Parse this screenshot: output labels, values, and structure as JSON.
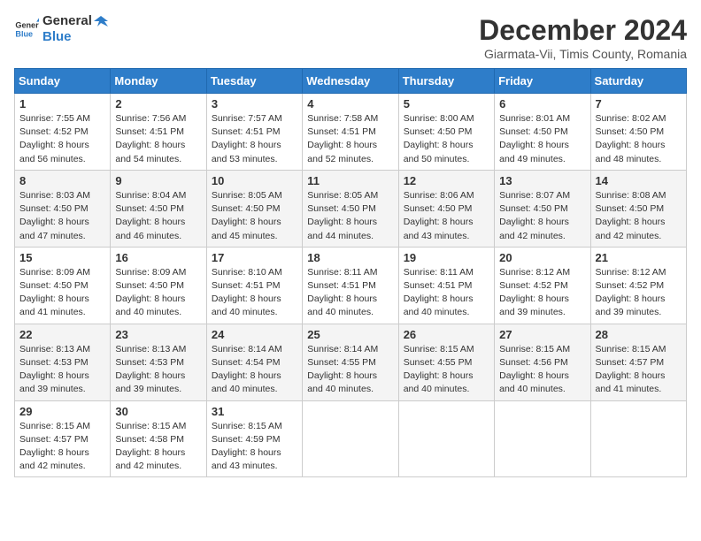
{
  "header": {
    "logo_general": "General",
    "logo_blue": "Blue",
    "month_title": "December 2024",
    "subtitle": "Giarmata-Vii, Timis County, Romania"
  },
  "weekdays": [
    "Sunday",
    "Monday",
    "Tuesday",
    "Wednesday",
    "Thursday",
    "Friday",
    "Saturday"
  ],
  "weeks": [
    [
      {
        "day": "1",
        "sunrise": "7:55 AM",
        "sunset": "4:52 PM",
        "daylight": "8 hours and 56 minutes."
      },
      {
        "day": "2",
        "sunrise": "7:56 AM",
        "sunset": "4:51 PM",
        "daylight": "8 hours and 54 minutes."
      },
      {
        "day": "3",
        "sunrise": "7:57 AM",
        "sunset": "4:51 PM",
        "daylight": "8 hours and 53 minutes."
      },
      {
        "day": "4",
        "sunrise": "7:58 AM",
        "sunset": "4:51 PM",
        "daylight": "8 hours and 52 minutes."
      },
      {
        "day": "5",
        "sunrise": "8:00 AM",
        "sunset": "4:50 PM",
        "daylight": "8 hours and 50 minutes."
      },
      {
        "day": "6",
        "sunrise": "8:01 AM",
        "sunset": "4:50 PM",
        "daylight": "8 hours and 49 minutes."
      },
      {
        "day": "7",
        "sunrise": "8:02 AM",
        "sunset": "4:50 PM",
        "daylight": "8 hours and 48 minutes."
      }
    ],
    [
      {
        "day": "8",
        "sunrise": "8:03 AM",
        "sunset": "4:50 PM",
        "daylight": "8 hours and 47 minutes."
      },
      {
        "day": "9",
        "sunrise": "8:04 AM",
        "sunset": "4:50 PM",
        "daylight": "8 hours and 46 minutes."
      },
      {
        "day": "10",
        "sunrise": "8:05 AM",
        "sunset": "4:50 PM",
        "daylight": "8 hours and 45 minutes."
      },
      {
        "day": "11",
        "sunrise": "8:05 AM",
        "sunset": "4:50 PM",
        "daylight": "8 hours and 44 minutes."
      },
      {
        "day": "12",
        "sunrise": "8:06 AM",
        "sunset": "4:50 PM",
        "daylight": "8 hours and 43 minutes."
      },
      {
        "day": "13",
        "sunrise": "8:07 AM",
        "sunset": "4:50 PM",
        "daylight": "8 hours and 42 minutes."
      },
      {
        "day": "14",
        "sunrise": "8:08 AM",
        "sunset": "4:50 PM",
        "daylight": "8 hours and 42 minutes."
      }
    ],
    [
      {
        "day": "15",
        "sunrise": "8:09 AM",
        "sunset": "4:50 PM",
        "daylight": "8 hours and 41 minutes."
      },
      {
        "day": "16",
        "sunrise": "8:09 AM",
        "sunset": "4:50 PM",
        "daylight": "8 hours and 40 minutes."
      },
      {
        "day": "17",
        "sunrise": "8:10 AM",
        "sunset": "4:51 PM",
        "daylight": "8 hours and 40 minutes."
      },
      {
        "day": "18",
        "sunrise": "8:11 AM",
        "sunset": "4:51 PM",
        "daylight": "8 hours and 40 minutes."
      },
      {
        "day": "19",
        "sunrise": "8:11 AM",
        "sunset": "4:51 PM",
        "daylight": "8 hours and 40 minutes."
      },
      {
        "day": "20",
        "sunrise": "8:12 AM",
        "sunset": "4:52 PM",
        "daylight": "8 hours and 39 minutes."
      },
      {
        "day": "21",
        "sunrise": "8:12 AM",
        "sunset": "4:52 PM",
        "daylight": "8 hours and 39 minutes."
      }
    ],
    [
      {
        "day": "22",
        "sunrise": "8:13 AM",
        "sunset": "4:53 PM",
        "daylight": "8 hours and 39 minutes."
      },
      {
        "day": "23",
        "sunrise": "8:13 AM",
        "sunset": "4:53 PM",
        "daylight": "8 hours and 39 minutes."
      },
      {
        "day": "24",
        "sunrise": "8:14 AM",
        "sunset": "4:54 PM",
        "daylight": "8 hours and 40 minutes."
      },
      {
        "day": "25",
        "sunrise": "8:14 AM",
        "sunset": "4:55 PM",
        "daylight": "8 hours and 40 minutes."
      },
      {
        "day": "26",
        "sunrise": "8:15 AM",
        "sunset": "4:55 PM",
        "daylight": "8 hours and 40 minutes."
      },
      {
        "day": "27",
        "sunrise": "8:15 AM",
        "sunset": "4:56 PM",
        "daylight": "8 hours and 40 minutes."
      },
      {
        "day": "28",
        "sunrise": "8:15 AM",
        "sunset": "4:57 PM",
        "daylight": "8 hours and 41 minutes."
      }
    ],
    [
      {
        "day": "29",
        "sunrise": "8:15 AM",
        "sunset": "4:57 PM",
        "daylight": "8 hours and 42 minutes."
      },
      {
        "day": "30",
        "sunrise": "8:15 AM",
        "sunset": "4:58 PM",
        "daylight": "8 hours and 42 minutes."
      },
      {
        "day": "31",
        "sunrise": "8:15 AM",
        "sunset": "4:59 PM",
        "daylight": "8 hours and 43 minutes."
      },
      null,
      null,
      null,
      null
    ]
  ],
  "labels": {
    "sunrise": "Sunrise:",
    "sunset": "Sunset:",
    "daylight": "Daylight:"
  }
}
